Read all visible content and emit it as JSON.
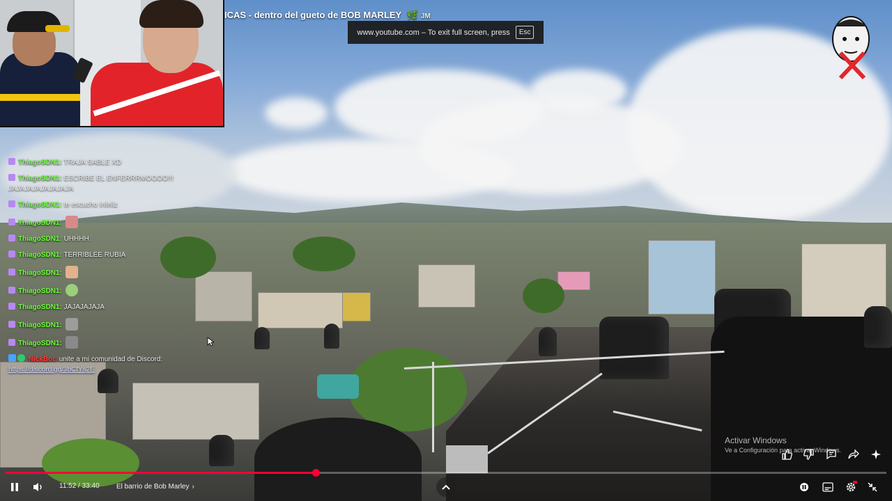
{
  "video": {
    "title": "ICAS - dentro del gueto de BOB MARLEY",
    "title_suffix": "JM"
  },
  "fullscreen_notice": {
    "text": "www.youtube.com – To exit full screen, press",
    "key": "Esc"
  },
  "chat": {
    "messages": [
      {
        "user": "ThiagoSDN1:",
        "text": "TRAJA SABLE XD"
      },
      {
        "user": "ThiagoSDN1:",
        "text": "ESCRIBE EL ENFERRRMOOOO!!! JAJAJAJAJAJAJAJA"
      },
      {
        "user": "ThiagoSDN1:",
        "text": "te escucho Infeliz"
      },
      {
        "user": "ThiagoSDN1:",
        "text": ""
      },
      {
        "user": "ThiagoSDN1:",
        "text": "UHHHH"
      },
      {
        "user": "ThiagoSDN1:",
        "text": "TERRIBLEE RUBIA"
      },
      {
        "user": "ThiagoSDN1:",
        "text": ""
      },
      {
        "user": "ThiagoSDN1:",
        "text": ""
      },
      {
        "user": "ThiagoSDN1:",
        "text": "JAJAJAJAJA"
      },
      {
        "user": "ThiagoSDN1:",
        "text": ""
      },
      {
        "user": "ThiagoSDN1:",
        "text": ""
      }
    ],
    "bot": {
      "user": "NickBot:",
      "text": "unite a mi comunidad de Discord:",
      "link": "https://discord.gg/3bCfYs2E"
    }
  },
  "watermark": {
    "line1": "Activar Windows",
    "line2": "Ve a Configuración para activar Windows."
  },
  "player": {
    "time": "11:52 / 33:40",
    "chapter": "El barrio de Bob Marley",
    "progress": 0.352,
    "colors": {
      "progress": "#ff0033",
      "chat_user": "#6dff3b"
    }
  },
  "icons": [
    "pause-icon",
    "volume-icon",
    "chevron-right-icon",
    "chevron-up-icon",
    "autoplay-icon",
    "subtitles-icon",
    "settings-icon",
    "exit-fullscreen-icon",
    "like-icon",
    "dislike-icon",
    "comment-icon",
    "share-icon",
    "sparkle-icon"
  ]
}
